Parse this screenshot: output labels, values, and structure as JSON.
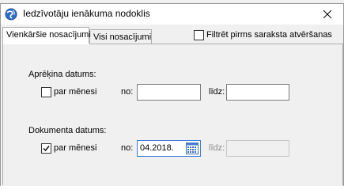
{
  "window": {
    "title": "Iedzīvotāju ienākuma nodoklis"
  },
  "tabs": [
    {
      "label": "Vienkāršie nosacījumi",
      "active": true
    },
    {
      "label": "Visi nosacījumi",
      "active": false
    }
  ],
  "filter": {
    "label": "Filtrēt pirms saraksta atvēršanas",
    "checked": false
  },
  "calc_date": {
    "heading": "Aprēķina datums:",
    "by_month_label": "par mēnesi",
    "by_month_checked": false,
    "from_label": "no:",
    "from_value": "",
    "to_label": "līdz:",
    "to_value": ""
  },
  "doc_date": {
    "heading": "Dokumenta datums:",
    "by_month_label": "par mēnesi",
    "by_month_checked": true,
    "from_label": "no:",
    "from_value": "04.2018.",
    "to_label": "līdz:",
    "to_value": ""
  },
  "icons": {
    "app": "globe-icon",
    "close": "close-icon",
    "calendar": "calendar-icon"
  },
  "colors": {
    "accent": "#3d7bd6",
    "app_icon": "#2e6fc4"
  }
}
